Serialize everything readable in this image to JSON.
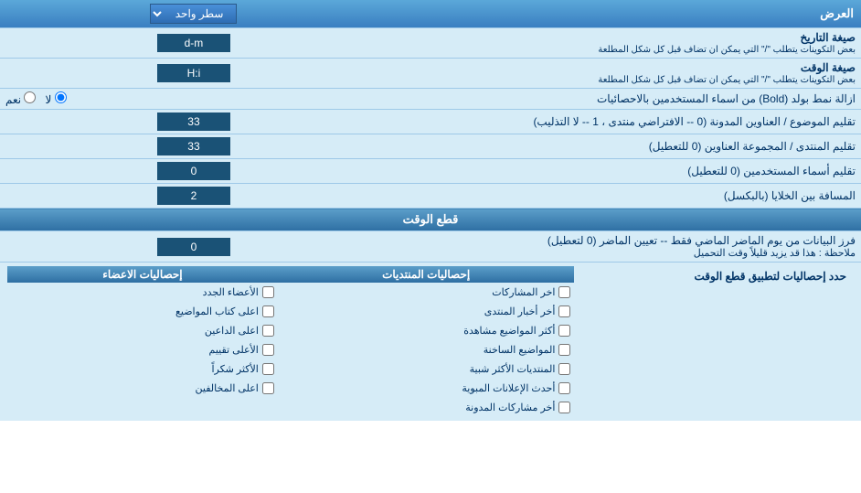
{
  "header": {
    "select_label": "سطر واحد",
    "display_label": "العرض"
  },
  "date_format": {
    "label": "صيغة التاريخ",
    "sublabel": "بعض التكوينات يتطلب \"/\" التي يمكن ان تضاف قبل كل شكل المطلعة",
    "value": "d-m"
  },
  "time_format": {
    "label": "صيغة الوقت",
    "sublabel": "بعض التكوينات يتطلب \"/\" التي يمكن ان تضاف قبل كل شكل المطلعة",
    "value": "H:i"
  },
  "bold_remove": {
    "label": "ازالة نمط بولد (Bold) من اسماء المستخدمين بالاحصائيات",
    "option_yes": "نعم",
    "option_no": "لا",
    "selected": "no"
  },
  "topics_titles": {
    "label": "تقليم الموضوع / العناوين المدونة (0 -- الافتراضي منتدى ، 1 -- لا التذليب)",
    "value": "33"
  },
  "forum_titles": {
    "label": "تقليم المنتدى / المجموعة العناوين (0 للتعطيل)",
    "value": "33"
  },
  "usernames": {
    "label": "تقليم أسماء المستخدمين (0 للتعطيل)",
    "value": "0"
  },
  "cell_spacing": {
    "label": "المسافة بين الخلايا (بالبكسل)",
    "value": "2"
  },
  "time_cut_section": {
    "title": "قطع الوقت"
  },
  "time_cut": {
    "label": "فرز البيانات من يوم الماضر الماضي فقط -- تعيين الماضر (0 لتعطيل)",
    "note": "ملاحظة : هذا قد يزيد قليلاً وقت التحميل",
    "value": "0"
  },
  "limit_section": {
    "label": "حدد إحصاليات لتطبيق قطع الوقت"
  },
  "col1_header": "إحصاليات المنتديات",
  "col2_header": "إحصاليات الاعضاء",
  "col1_items": [
    "اخر المشاركات",
    "أخر أخبار المنتدى",
    "أكثر المواضيع مشاهدة",
    "المواضيع الساخنة",
    "المنتديات الأكثر شبية",
    "أحدث الإعلانات المبوية",
    "أخر مشاركات المدونة"
  ],
  "col2_items": [
    "الأعضاء الجدد",
    "اعلى كتاب المواضيع",
    "اعلى الداعين",
    "الأعلى تقييم",
    "الأكثر شكراً",
    "اعلى المخالفين"
  ]
}
